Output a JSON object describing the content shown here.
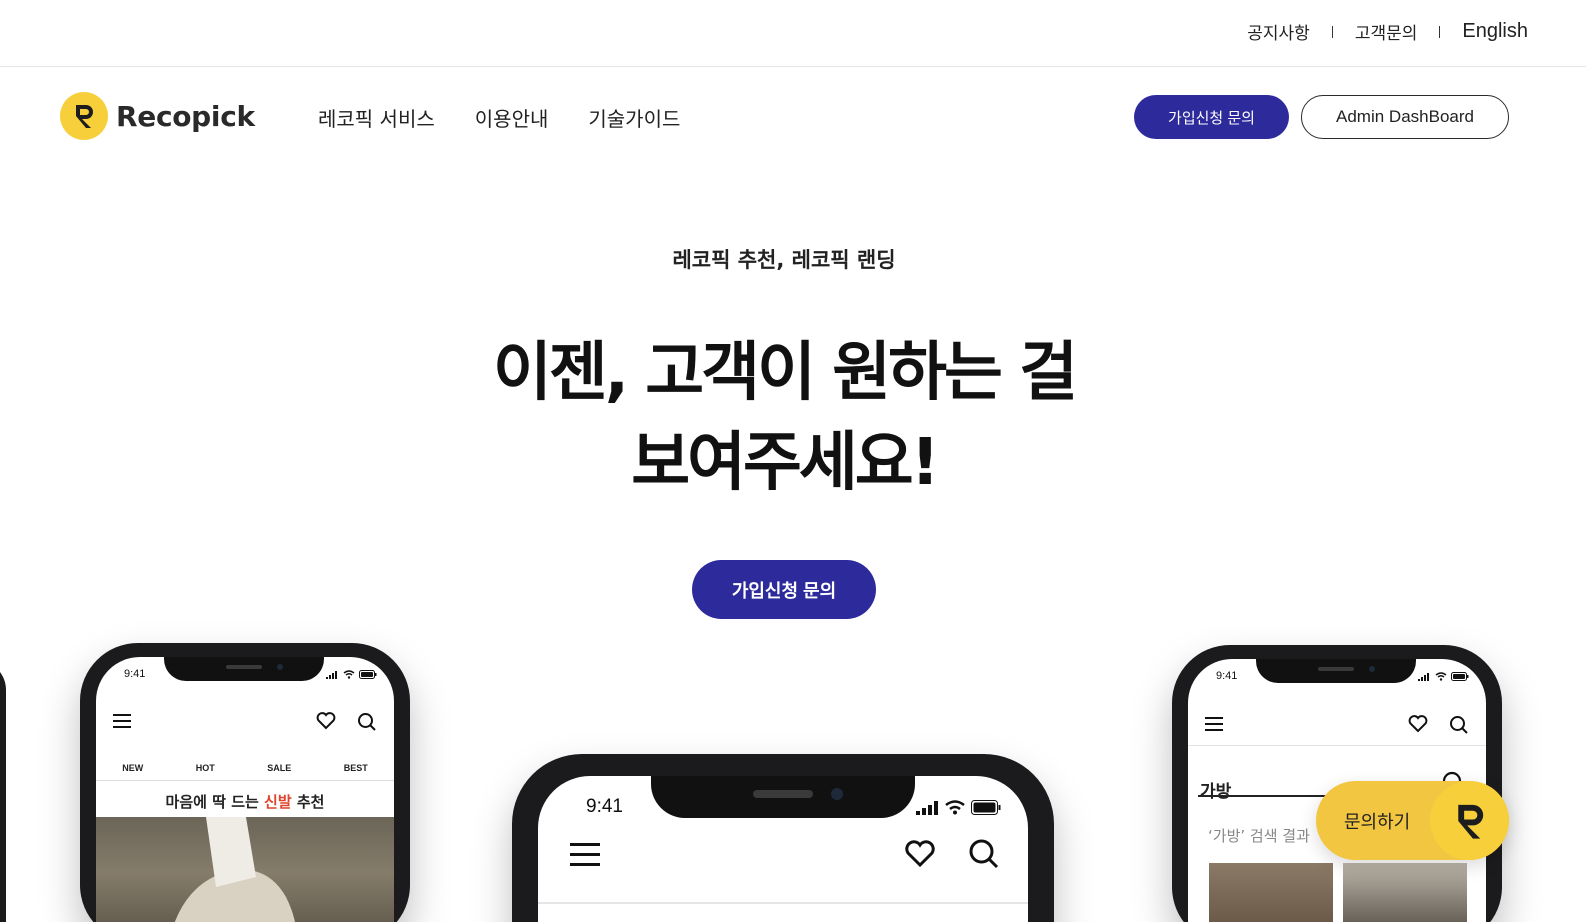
{
  "utility_nav": {
    "notice": "공지사항",
    "support": "고객문의",
    "language": "English"
  },
  "header": {
    "logo_text": "Recopick",
    "menu": [
      {
        "label": "레코픽 서비스"
      },
      {
        "label": "이용안내"
      },
      {
        "label": "기술가이드"
      }
    ],
    "join_button": "가입신청 문의",
    "admin_button": "Admin DashBoard"
  },
  "hero": {
    "eyebrow": "레코픽 추천, 레코픽 랜딩",
    "title_line1": "이젠, 고객이 원하는 걸",
    "title_line2": "보여주세요!",
    "cta": "가입신청 문의"
  },
  "phones": {
    "left": {
      "time": "9:41",
      "tabs": [
        "NEW",
        "HOT",
        "SALE",
        "BEST"
      ],
      "promo_prefix": "마음에 딱 드는 ",
      "promo_highlight": "신발",
      "promo_suffix": " 추천"
    },
    "center": {
      "time": "9:41"
    },
    "right": {
      "time": "9:41",
      "search_title": "가방",
      "result_text": "‘가방’ 검색 결과"
    }
  },
  "floating": {
    "inquiry_label": "문의하기"
  },
  "colors": {
    "primary": "#2d2a9c",
    "accent_yellow": "#f6cf3b",
    "highlight_red": "#e0442d"
  },
  "icons": [
    "menu-icon",
    "heart-icon",
    "search-icon",
    "signal-icon",
    "wifi-icon",
    "battery-icon",
    "recopick-logo-icon"
  ]
}
